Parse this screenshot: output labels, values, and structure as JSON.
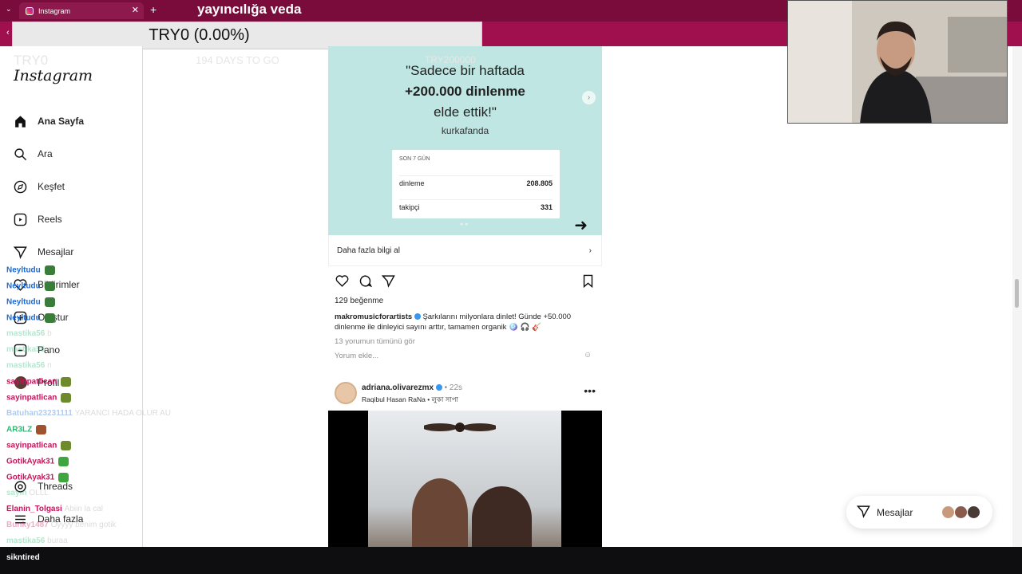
{
  "browser": {
    "tab_title": "Instagram",
    "stream_title": "yayıncılığa veda"
  },
  "overlay": {
    "ticker": "TRY0 (0.00%)",
    "ghost_try": "TRY0",
    "ghost_days": "194 DAYS TO GO",
    "ghost_goal": "TRY200000"
  },
  "sidebar": {
    "logo": "Instagram",
    "items": [
      {
        "label": "Ana Sayfa",
        "icon": "home-icon"
      },
      {
        "label": "Ara",
        "icon": "search-icon"
      },
      {
        "label": "Keşfet",
        "icon": "compass-icon"
      },
      {
        "label": "Reels",
        "icon": "reels-icon"
      },
      {
        "label": "Mesajlar",
        "icon": "send-icon"
      },
      {
        "label": "Bildirimler",
        "icon": "heart-icon"
      },
      {
        "label": "Oluştur",
        "icon": "plus-icon"
      },
      {
        "label": "Pano",
        "icon": "dashboard-icon"
      },
      {
        "label": "Profil",
        "icon": "avatar-icon"
      },
      {
        "label": "Threads",
        "icon": "threads-icon"
      },
      {
        "label": "Daha fazla",
        "icon": "menu-icon"
      }
    ]
  },
  "post1": {
    "quote_line1": "\"Sadece bir haftada",
    "quote_line2": "+200.000 dinlenme",
    "quote_line3": "elde ettik!\"",
    "author": "kurkafanda",
    "stats_header": "SON 7 GÜN",
    "stats": [
      {
        "label": "dinleme",
        "value": "208.805"
      },
      {
        "label": "takipçi",
        "value": "331"
      }
    ],
    "cta": "Daha fazla bilgi al",
    "likes": "129 beğenme",
    "username": "makromusicforartists",
    "caption": "Şarkılarını milyonlara dinlet! Günde +50.000 dinlenme ile dinleyici sayını arttır, tamamen organik 🪩 🎧 🎸",
    "view_comments": "13 yorumun tümünü gör",
    "add_comment": "Yorum ekle..."
  },
  "post2": {
    "username": "adriana.olivarezmx",
    "time": "• 22s",
    "music": "Raqibul Hasan RaNa • লুকা সাপা"
  },
  "messages_pill": {
    "label": "Mesajlar"
  },
  "chat": [
    {
      "user": "Neyltudu",
      "color": "#1e6bd6"
    },
    {
      "user": "Neyltudu",
      "color": "#1e6bd6"
    },
    {
      "user": "Neyltudu",
      "color": "#1e6bd6"
    },
    {
      "user": "Neyltudu",
      "color": "#1e6bd6"
    },
    {
      "user": "mastika56",
      "color": "#2bb673",
      "msg": "b",
      "faded": true
    },
    {
      "user": "mastika56",
      "color": "#2bb673",
      "msg": "a",
      "faded": true
    },
    {
      "user": "mastika56",
      "color": "#2bb673",
      "msg": "n",
      "faded": true
    },
    {
      "user": "sayinpatlican",
      "color": "#c0185a"
    },
    {
      "user": "sayinpatlican",
      "color": "#c0185a"
    },
    {
      "user": "Batuhan23231111",
      "color": "#1e6bd6",
      "msg": "YARANCI HADA OLUR AU",
      "faded": true
    },
    {
      "user": "AR3LZ",
      "color": "#2bb673"
    },
    {
      "user": "sayinpatlican",
      "color": "#c0185a"
    },
    {
      "user": "GotikAyak31",
      "color": "#c0185a"
    },
    {
      "user": "GotikAyak31",
      "color": "#c0185a"
    },
    {
      "user": "sayın",
      "color": "#2bb673",
      "msg": "OLLL",
      "faded": true
    },
    {
      "user": "Elanin_Tolgasi",
      "color": "#c0185a",
      "msg": "Abiin la cal",
      "faded": true
    },
    {
      "user": "Bunky1487",
      "color": "#c0185a",
      "msg": "Oyyyy benim gotik",
      "faded": true
    },
    {
      "user": "mastika56",
      "color": "#2bb673",
      "msg": "buraa",
      "faded": true
    }
  ],
  "bottom_bar": {
    "user": "sikntired"
  }
}
